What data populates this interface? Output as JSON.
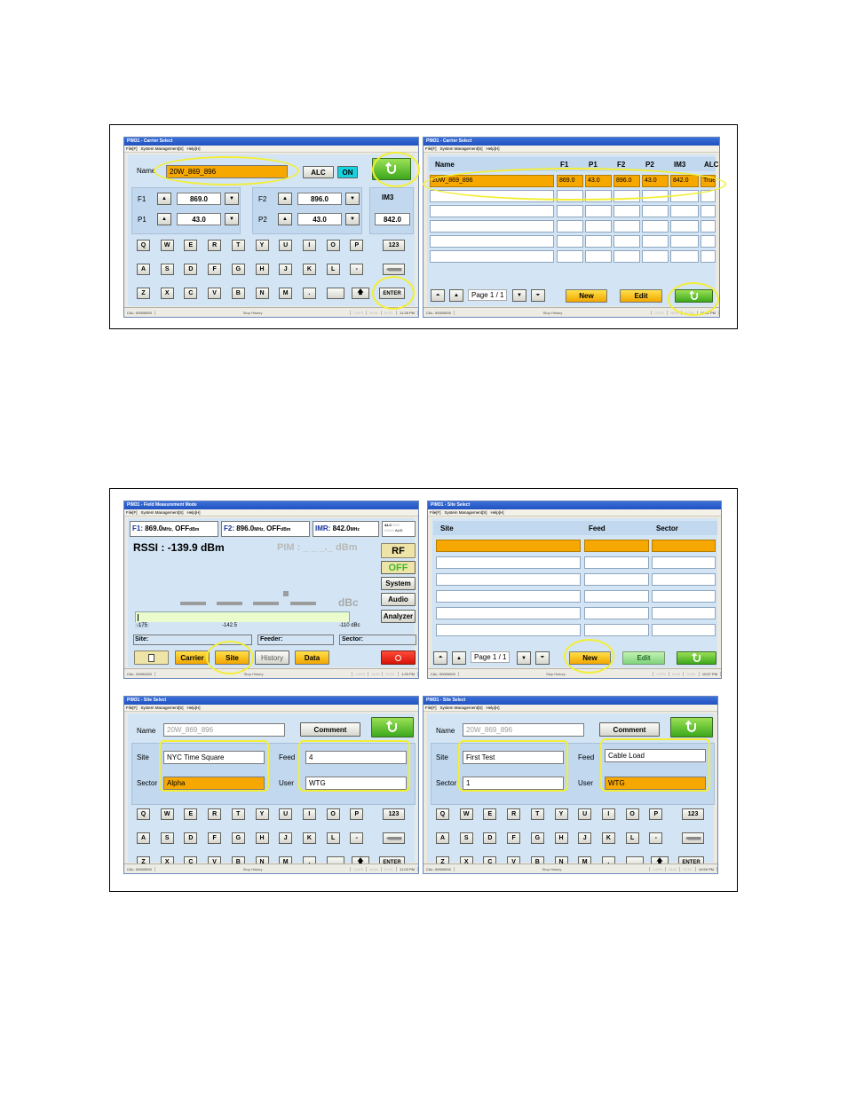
{
  "keyboard": {
    "row1": [
      "Q",
      "W",
      "E",
      "R",
      "T",
      "Y",
      "U",
      "I",
      "O",
      "P",
      "123"
    ],
    "row2": [
      "A",
      "S",
      "D",
      "F",
      "G",
      "H",
      "J",
      "K",
      "L",
      "-"
    ],
    "row3": [
      "Z",
      "X",
      "C",
      "V",
      "B",
      "N",
      "M",
      "."
    ],
    "enter": "ENTER"
  },
  "menu": {
    "file": "File[F]",
    "sys": "System Management[S]",
    "help": "Help[H]"
  },
  "status": {
    "stop": "Stop History",
    "caps": "CAPS",
    "num": "NUM",
    "scrl": "SCRL"
  },
  "win1": {
    "title": "PIM31 - Carrier Select",
    "name_label": "Name",
    "name_value": "20W_869_896",
    "alc": "ALC",
    "on": "ON",
    "f1_label": "F1",
    "f1": "869.0",
    "p1_label": "P1",
    "p1": "43.0",
    "f2_label": "F2",
    "f2": "896.0",
    "p2_label": "P2",
    "p2": "43.0",
    "im3_label": "IM3",
    "im3": "842.0",
    "cal": "CAL: 00000000",
    "time": "11:28 PM"
  },
  "win2": {
    "title": "PIM31 - Carrier Select",
    "headers": [
      "Name",
      "F1",
      "P1",
      "F2",
      "P2",
      "IM3",
      "ALC"
    ],
    "row": [
      "20W_869_896",
      "869.0",
      "43.0",
      "896.0",
      "43.0",
      "842.0",
      "True"
    ],
    "page": "Page 1 / 1",
    "new": "New",
    "edit": "Edit",
    "cal": "CAL: 00000000",
    "time": "10:31 PM"
  },
  "win3": {
    "title": "PIM31 - Field Measurement Mode",
    "f1_label": "F1:",
    "f1": "869.0",
    "f1_unit": "MHz,",
    "f1_off": "OFF",
    "f1_dbm": "dBm",
    "f2_label": "F2:",
    "f2": "896.0",
    "f2_unit": "MHz,",
    "f2_off": "OFF",
    "f2_dbm": "dBm",
    "imr_label": "IMR:",
    "imr": "842.0",
    "imr_unit": "MHz",
    "alc": "ALC",
    "alc2": "RSC",
    "alc3": "HOLD",
    "alc4": "AUD",
    "rssi": "RSSI : -139.9  dBm",
    "pim": "PIM : _ _ _._  dBm",
    "dbc": "dBc",
    "scale_min": "-175",
    "scale_mid": "-142.5",
    "scale_max": "-110  dBc",
    "rf": "RF",
    "off": "OFF",
    "system": "System",
    "audio": "Audio",
    "analyzer": "Analyzer",
    "site_label": "Site:",
    "feeder_label": "Feeder:",
    "sector_label": "Sector:",
    "carrier": "Carrier",
    "site": "Site",
    "history": "History",
    "data": "Data",
    "cal": "CAL: 20091020",
    "time": "1:29 PM"
  },
  "win4": {
    "title": "PIM31 - Site Select",
    "headers": [
      "Site",
      "Feed",
      "Sector"
    ],
    "page": "Page 1 / 1",
    "new": "New",
    "edit": "Edit",
    "cal": "CAL: 00000000",
    "time": "10:57 PM"
  },
  "win5": {
    "title": "PIM31 - Site Select",
    "name_label": "Name",
    "name_value": "20W_869_896",
    "comment": "Comment",
    "site_label": "Site",
    "site": "NYC Time Square",
    "feed_label": "Feed",
    "feed": "4",
    "sector_label": "Sector",
    "sector": "Alpha",
    "user_label": "User",
    "user": "WTG",
    "cal": "CAL: 00000000",
    "time": "11:03 PM"
  },
  "win6": {
    "title": "PIM31 - Site Select",
    "name_label": "Name",
    "name_value": "20W_869_896",
    "comment": "Comment",
    "site_label": "Site",
    "site": "First Test",
    "feed_label": "Feed",
    "feed": "Cable Load",
    "sector_label": "Sector",
    "sector": "1",
    "user_label": "User",
    "user": "WTG",
    "cal": "CAL: 00000000",
    "time": "10:59 PM"
  }
}
